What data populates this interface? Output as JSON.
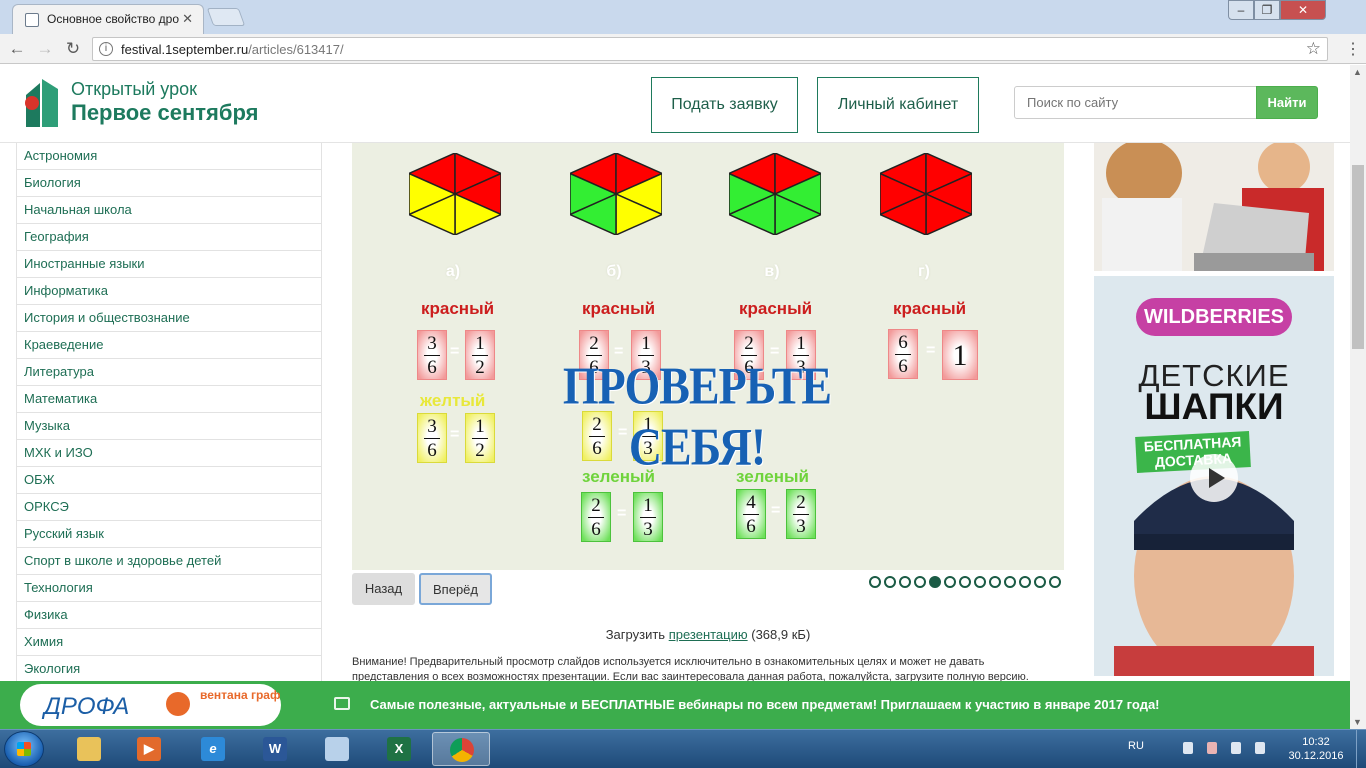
{
  "browser": {
    "tab_title": "Основное свойство дро",
    "url_host": "festival.1september.ru",
    "url_path": "/articles/613417/"
  },
  "header": {
    "logo_line1": "Открытый урок",
    "logo_line2": "Первое сентября",
    "apply_button": "Подать заявку",
    "cabinet_button": "Личный кабинет",
    "search_placeholder": "Поиск по сайту",
    "search_button": "Найти"
  },
  "sidebar": {
    "items": [
      "Астрономия",
      "Биология",
      "Начальная школа",
      "География",
      "Иностранные языки",
      "Информатика",
      "История и обществознание",
      "Краеведение",
      "Литература",
      "Математика",
      "Музыка",
      "МХК и ИЗО",
      "ОБЖ",
      "ОРКСЭ",
      "Русский язык",
      "Спорт в школе и здоровье детей",
      "Технология",
      "Физика",
      "Химия",
      "Экология"
    ]
  },
  "slide": {
    "letters": [
      "а)",
      "б)",
      "в)",
      "г)"
    ],
    "words": {
      "red": "красный",
      "yellow": "желтый",
      "green": "зеленый"
    },
    "check_title": "ПРОВЕРЬТЕ СЕБЯ!",
    "eq": "=",
    "fractions": {
      "a_red_left": {
        "n": "3",
        "d": "6"
      },
      "a_red_right": {
        "n": "1",
        "d": "2"
      },
      "a_yellow_left": {
        "n": "3",
        "d": "6"
      },
      "a_yellow_right": {
        "n": "1",
        "d": "2"
      },
      "b_red_left": {
        "n": "2",
        "d": "6"
      },
      "b_red_right": {
        "n": "1",
        "d": "3"
      },
      "b_yellow_left": {
        "n": "2",
        "d": "6"
      },
      "b_yellow_right": {
        "n": "1",
        "d": "3"
      },
      "b_green_left": {
        "n": "2",
        "d": "6"
      },
      "b_green_right": {
        "n": "1",
        "d": "3"
      },
      "c_red_left": {
        "n": "2",
        "d": "6"
      },
      "c_red_right": {
        "n": "1",
        "d": "3"
      },
      "c_green_left": {
        "n": "4",
        "d": "6"
      },
      "c_green_right": {
        "n": "2",
        "d": "3"
      },
      "d_red_left": {
        "n": "6",
        "d": "6"
      },
      "d_red_right": "1"
    },
    "hex_colors": {
      "red": "#ff0000",
      "yellow": "#ffff00",
      "green": "#33ee33"
    }
  },
  "controls": {
    "back": "Назад",
    "next": "Вперёд",
    "total_slides": 13,
    "active_slide": 5
  },
  "download": {
    "prefix": "Загрузить",
    "link": "презентацию",
    "size": "(368,9 кБ)"
  },
  "notice": "Внимание! Предварительный просмотр слайдов используется исключительно в ознакомительных целях и может не давать представления о всех возможностях презентации. Если вас заинтересовала данная работа, пожалуйста, загрузите полную версию.",
  "ad": {
    "wb_logo": "WILDBERRIES",
    "wb_line1": "ДЕТСКИЕ",
    "wb_line2": "ШАПКИ",
    "wb_promo": "БЕСПЛАТНАЯ ДОСТАВКА"
  },
  "promo": {
    "drofa": "ДРОФА",
    "ventana": "вентана граф",
    "text": "Самые полезные, актуальные и БЕСПЛАТНЫЕ вебинары по всем предметам! Приглашаем к участию в январе 2017 года!"
  },
  "taskbar": {
    "lang": "RU",
    "time": "10:32",
    "date": "30.12.2016",
    "word_glyph": "W",
    "excel_glyph": "X"
  }
}
